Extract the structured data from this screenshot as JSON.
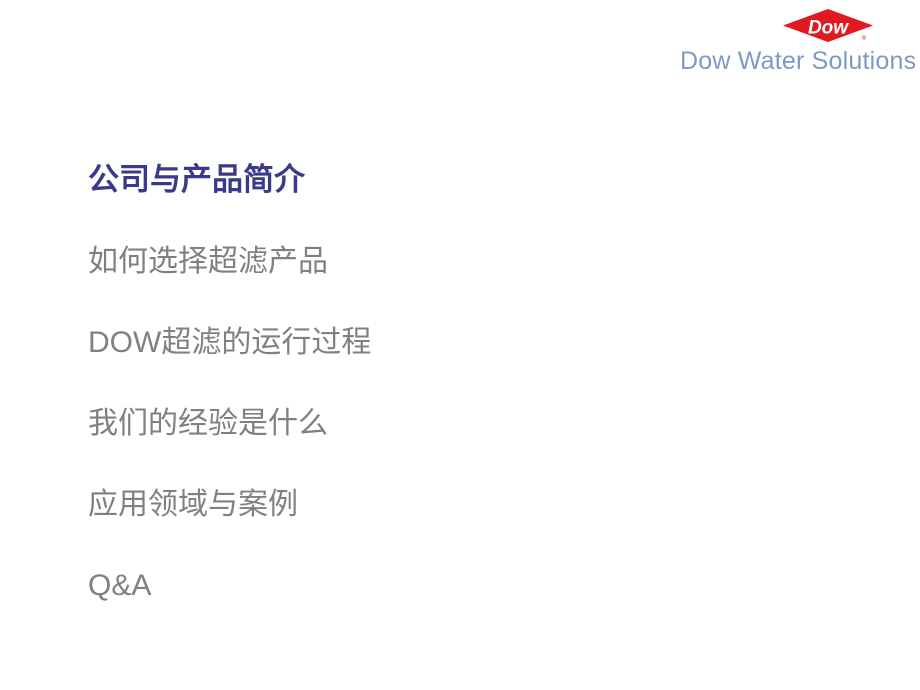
{
  "brand": {
    "logo_text": "Dow",
    "logo_trademark": "®",
    "wordmark": "Dow Water Solutions",
    "logo_color": "#e01a22",
    "wordmark_color": "#7e99c6"
  },
  "agenda": {
    "items": [
      {
        "label": "公司与产品简介",
        "bullet": "rose-picture-bullet",
        "active": true,
        "color": "#393a8c"
      },
      {
        "label": "如何选择超滤产品",
        "bullet": "gold-sphere-bullet",
        "active": false,
        "color": "#808080"
      },
      {
        "label": "DOW超滤的运行过程",
        "bullet": "gold-sphere-bullet",
        "active": false,
        "color": "#808080"
      },
      {
        "label": "我们的经验是什么",
        "bullet": "gold-sphere-bullet",
        "active": false,
        "color": "#808080"
      },
      {
        "label": "应用领域与案例",
        "bullet": "gold-sphere-bullet",
        "active": false,
        "color": "#808080"
      },
      {
        "label": "Q&A",
        "bullet": "gold-sphere-bullet",
        "active": false,
        "color": "#808080"
      }
    ]
  },
  "slide": {
    "background_color": "#ffffff"
  }
}
